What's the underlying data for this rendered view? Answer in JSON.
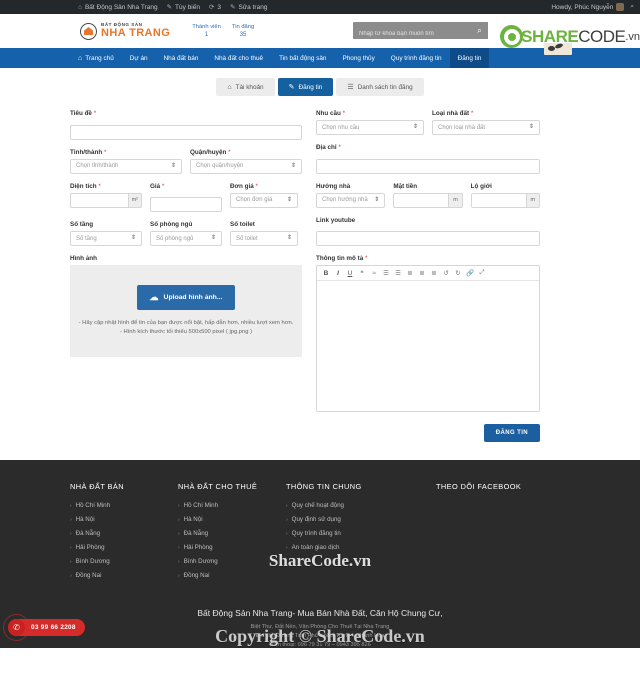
{
  "adminbar": {
    "site_icon": "wordpress-dashboard-icon",
    "site_name": "Bất Động Sản Nha Trang",
    "customize_icon": "pencil-icon",
    "customize": "Tùy biến",
    "updates_icon": "refresh-icon",
    "updates_count": "3",
    "edit_icon": "pencil-icon",
    "edit_page": "Sửa trang",
    "howdy": "Howdy, Phúc Nguyễn",
    "search_icon": "search-icon"
  },
  "header": {
    "logo_top": "BẤT ĐỘNG SẢN",
    "logo_bottom": "NHA TRANG",
    "stats": [
      {
        "label": "Thành viên",
        "value": "1"
      },
      {
        "label": "Tin đăng",
        "value": "35"
      }
    ],
    "search_placeholder": "Nhập từ khóa bạn muốn tìm",
    "search_value": "",
    "search_icon": "search-icon",
    "brand_share": "SHARE",
    "brand_code": "CODE",
    "brand_vn": ".vn",
    "brand_color": "#6cb33f"
  },
  "nav": {
    "home_icon": "home-icon",
    "items": [
      {
        "label": "Trang chủ",
        "active": false
      },
      {
        "label": "Dự án",
        "active": false
      },
      {
        "label": "Nhà đất bán",
        "active": false
      },
      {
        "label": "Nhà đất cho thuê",
        "active": false
      },
      {
        "label": "Tin bất động sản",
        "active": false
      },
      {
        "label": "Phong thủy",
        "active": false
      },
      {
        "label": "Quy trình đăng tin",
        "active": false
      },
      {
        "label": "Đăng tin",
        "active": true
      }
    ],
    "bg_color": "#1561ab",
    "active_bg_color": "#0d4c88"
  },
  "tabs": [
    {
      "label": "Tài khoản",
      "icon": "home-icon",
      "active": false
    },
    {
      "label": "Đăng tin",
      "icon": "pencil-icon",
      "active": true
    },
    {
      "label": "Danh sách tin đăng",
      "icon": "list-icon",
      "active": false
    }
  ],
  "form": {
    "title": {
      "label": "Tiêu đề",
      "required": "*",
      "value": "",
      "placeholder": ""
    },
    "province": {
      "label": "Tỉnh/thành",
      "required": "*",
      "value": "Chọn tỉnh/thành"
    },
    "district": {
      "label": "Quận/huyện",
      "required": "*",
      "value": "Chọn quận/huyện"
    },
    "area": {
      "label": "Diện tích",
      "required": "*",
      "value": "",
      "unit": "m²"
    },
    "price": {
      "label": "Giá",
      "required": "*",
      "value": ""
    },
    "unit_price": {
      "label": "Đơn giá",
      "required": "*",
      "value": "Chọn đơn giá"
    },
    "floors": {
      "label": "Số tầng",
      "required": "",
      "value": "Số tầng"
    },
    "bedrooms": {
      "label": "Số phòng ngủ",
      "required": "",
      "value": "Số phòng ngủ"
    },
    "toilets": {
      "label": "Số toilet",
      "required": "",
      "value": "Số toilet"
    },
    "demand": {
      "label": "Nhu cầu",
      "required": "*",
      "value": "Chọn nhu cầu"
    },
    "property_type": {
      "label": "Loại nhà đất",
      "required": "*",
      "value": "Chọn loại nhà đất"
    },
    "address": {
      "label": "Địa chỉ",
      "required": "*",
      "value": ""
    },
    "direction": {
      "label": "Hướng nhà",
      "required": "",
      "value": "Chọn hướng nhà"
    },
    "frontage": {
      "label": "Mặt tiền",
      "required": "",
      "value": "",
      "unit": "m"
    },
    "road_width": {
      "label": "Lộ giới",
      "required": "",
      "value": "",
      "unit": "m"
    },
    "youtube": {
      "label": "Link youtube",
      "required": "",
      "value": ""
    },
    "images": {
      "label": "Hình ảnh",
      "button": "Upload hình ảnh...",
      "button_icon": "cloud-upload-icon",
      "note1": "- Hãy cập nhật hình để tin của bạn được nổi bật, hấp dẫn hơn, nhiều lượt xem hơn.",
      "note2": "- Hình kích thước tối thiểu 500x500 pixel ( jpg.png )"
    },
    "description": {
      "label": "Thông tin mô tả",
      "required": "*",
      "value": "",
      "toolbar": [
        {
          "icon": "bold-icon",
          "glyph": "B"
        },
        {
          "icon": "italic-icon",
          "glyph": "I"
        },
        {
          "icon": "underline-icon",
          "glyph": "U"
        },
        {
          "icon": "blockquote-icon",
          "glyph": "❝"
        },
        {
          "icon": "strikethrough-icon",
          "glyph": "≈"
        },
        {
          "icon": "ordered-list-icon",
          "glyph": "☰"
        },
        {
          "icon": "unordered-list-icon",
          "glyph": "☰"
        },
        {
          "icon": "align-left-icon",
          "glyph": "≣"
        },
        {
          "icon": "align-center-icon",
          "glyph": "≣"
        },
        {
          "icon": "align-right-icon",
          "glyph": "≣"
        },
        {
          "icon": "undo-icon",
          "glyph": "↺"
        },
        {
          "icon": "redo-icon",
          "glyph": "↻"
        },
        {
          "icon": "link-icon",
          "glyph": "🔗"
        },
        {
          "icon": "fullscreen-icon",
          "glyph": "⤢"
        }
      ]
    },
    "submit": "ĐĂNG TIN"
  },
  "footer": {
    "columns": [
      {
        "title": "NHÀ ĐẤT BÁN",
        "items": [
          "Hồ Chí Minh",
          "Hà Nội",
          "Đà Nẵng",
          "Hải Phòng",
          "Bình Dương",
          "Đồng Nai"
        ]
      },
      {
        "title": "NHÀ ĐẤT CHO THUÊ",
        "items": [
          "Hồ Chí Minh",
          "Hà Nội",
          "Đà Nẵng",
          "Hải Phòng",
          "Bình Dương",
          "Đồng Nai"
        ]
      },
      {
        "title": "THÔNG TIN CHUNG",
        "items": [
          "Quy chế hoạt động",
          "Quy định sử dụng",
          "Quy trình đăng tin",
          "An toàn giao dịch"
        ]
      },
      {
        "title": "THEO DÕI FACEBOOK",
        "items": []
      }
    ],
    "bottom_line1": "Bất Động Sản Nha Trang- Mua Bán Nhà Đất, Căn Hộ Chung Cư,",
    "bottom_line2": "Biệt Thự, Đất Nền, Văn Phòng Cho Thuê Tại Nha Trang",
    "bottom_line3": "Địa chỉ: Đường Trần Phú – Nha Trang – Khánh Hòa",
    "bottom_line4": "Điện thoại: 096 79 31 79 – 0943 395 826",
    "phone_icon": "phone-icon",
    "phone_number": "03 99 66 2208"
  },
  "watermark": {
    "middle": "ShareCode.vn",
    "bottom": "Copyright © ShareCode.vn"
  }
}
